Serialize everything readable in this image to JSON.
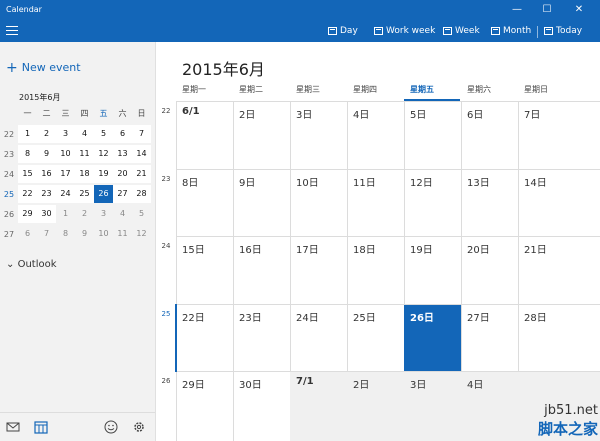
{
  "app": {
    "title": "Calendar"
  },
  "window_controls": {
    "minimize": "—",
    "maximize": "☐",
    "close": "✕"
  },
  "toolbar": {
    "day": "Day",
    "work_week": "Work week",
    "week": "Week",
    "month": "Month",
    "today": "Today"
  },
  "sidebar": {
    "new_event": "New event",
    "mini_title": "2015年6月",
    "weekday_headers": [
      "一",
      "二",
      "三",
      "四",
      "五",
      "六",
      "日"
    ],
    "weeks": [
      {
        "num": "22",
        "days": [
          "1",
          "2",
          "3",
          "4",
          "5",
          "6",
          "7"
        ]
      },
      {
        "num": "23",
        "days": [
          "8",
          "9",
          "10",
          "11",
          "12",
          "13",
          "14"
        ]
      },
      {
        "num": "24",
        "days": [
          "15",
          "16",
          "17",
          "18",
          "19",
          "20",
          "21"
        ]
      },
      {
        "num": "25",
        "days": [
          "22",
          "23",
          "24",
          "25",
          "26",
          "27",
          "28"
        ]
      },
      {
        "num": "26",
        "days": [
          "29",
          "30",
          "1",
          "2",
          "3",
          "4",
          "5"
        ]
      },
      {
        "num": "27",
        "days": [
          "6",
          "7",
          "8",
          "9",
          "10",
          "11",
          "12"
        ]
      }
    ],
    "outlook": "Outlook"
  },
  "main": {
    "title": "2015年6月",
    "day_headers": [
      "星期一",
      "星期二",
      "星期三",
      "星期四",
      "星期五",
      "星期六",
      "星期日"
    ],
    "weeks": [
      {
        "num": "22",
        "days": [
          "6/1",
          "2日",
          "3日",
          "4日",
          "5日",
          "6日",
          "7日"
        ]
      },
      {
        "num": "23",
        "days": [
          "8日",
          "9日",
          "10日",
          "11日",
          "12日",
          "13日",
          "14日"
        ]
      },
      {
        "num": "24",
        "days": [
          "15日",
          "16日",
          "17日",
          "18日",
          "19日",
          "20日",
          "21日"
        ]
      },
      {
        "num": "25",
        "days": [
          "22日",
          "23日",
          "24日",
          "25日",
          "26日",
          "27日",
          "28日"
        ]
      },
      {
        "num": "26",
        "days": [
          "29日",
          "30日",
          "7/1",
          "2日",
          "3日",
          "4日",
          ""
        ]
      }
    ]
  },
  "watermark": {
    "url": "jb51.net",
    "cn": "脚本之家"
  },
  "colors": {
    "accent": "#1366b8",
    "sidebar_bg": "#f2f2f2"
  }
}
